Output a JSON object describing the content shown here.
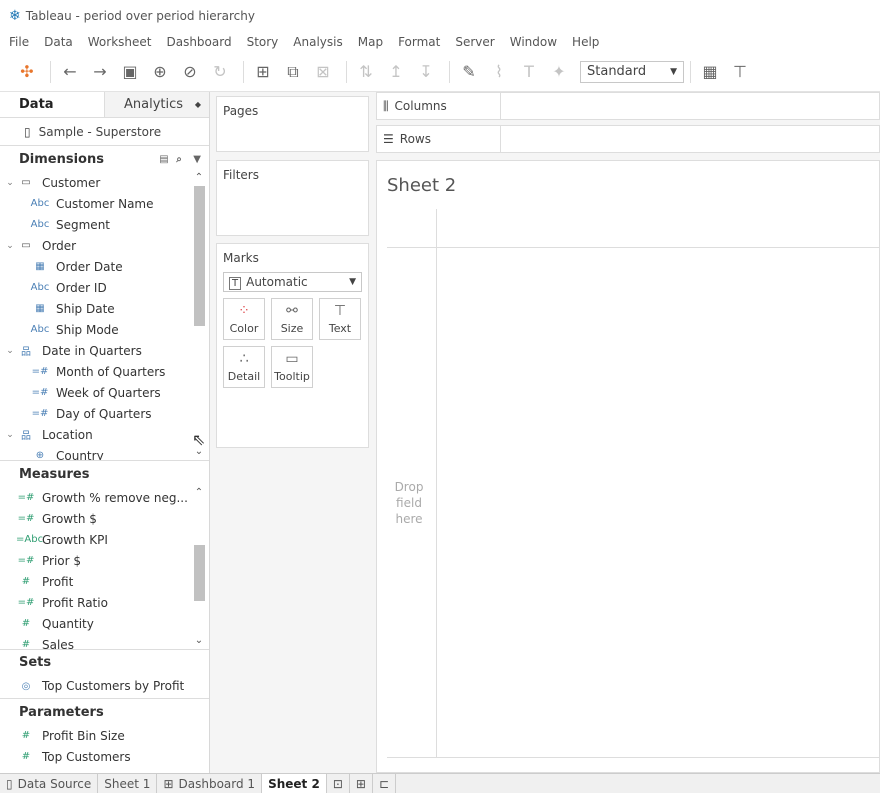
{
  "window": {
    "title": "Tableau - period over period hierarchy"
  },
  "menu": [
    "File",
    "Data",
    "Worksheet",
    "Dashboard",
    "Story",
    "Analysis",
    "Map",
    "Format",
    "Server",
    "Window",
    "Help"
  ],
  "toolbar": {
    "fit_value": "Standard"
  },
  "left_panel": {
    "tabs": [
      {
        "label": "Data"
      },
      {
        "label": "Analytics"
      }
    ],
    "data_source": "Sample - Superstore",
    "dimensions_title": "Dimensions",
    "dimensions": [
      {
        "label": "Customer",
        "kind": "folder"
      },
      {
        "label": "Customer Name",
        "kind": "abc"
      },
      {
        "label": "Segment",
        "kind": "abc"
      },
      {
        "label": "Order",
        "kind": "folder"
      },
      {
        "label": "Order Date",
        "kind": "date"
      },
      {
        "label": "Order ID",
        "kind": "abc"
      },
      {
        "label": "Ship Date",
        "kind": "date"
      },
      {
        "label": "Ship Mode",
        "kind": "abc"
      },
      {
        "label": "Date in Quarters",
        "kind": "hierarchy"
      },
      {
        "label": "Month of Quarters",
        "kind": "calc"
      },
      {
        "label": "Week of Quarters",
        "kind": "calc"
      },
      {
        "label": "Day of Quarters",
        "kind": "calc"
      },
      {
        "label": "Location",
        "kind": "hierarchy"
      },
      {
        "label": "Country",
        "kind": "geo"
      }
    ],
    "measures_title": "Measures",
    "measures": [
      {
        "label": "Growth % remove neg...",
        "kind": "calc"
      },
      {
        "label": "Growth $",
        "kind": "calc"
      },
      {
        "label": "Growth KPI",
        "kind": "abc-calc"
      },
      {
        "label": "Prior $",
        "kind": "calc"
      },
      {
        "label": "Profit",
        "kind": "num"
      },
      {
        "label": "Profit Ratio",
        "kind": "calc"
      },
      {
        "label": "Quantity",
        "kind": "num"
      },
      {
        "label": "Sales",
        "kind": "num"
      }
    ],
    "sets_title": "Sets",
    "sets": [
      {
        "label": "Top Customers by Profit"
      }
    ],
    "parameters_title": "Parameters",
    "parameters": [
      {
        "label": "Profit Bin Size"
      },
      {
        "label": "Top Customers"
      }
    ]
  },
  "cards": {
    "pages": "Pages",
    "filters": "Filters",
    "marks": "Marks",
    "marks_type": "Automatic",
    "mark_buttons": [
      "Color",
      "Size",
      "Text",
      "Detail",
      "Tooltip"
    ]
  },
  "view": {
    "columns_label": "Columns",
    "rows_label": "Rows",
    "sheet_title": "Sheet 2",
    "drop_hint": "Drop field here"
  },
  "bottom_tabs": [
    {
      "label": "Data Source"
    },
    {
      "label": "Sheet 1"
    },
    {
      "label": "Dashboard 1"
    },
    {
      "label": "Sheet 2",
      "active": true
    }
  ]
}
